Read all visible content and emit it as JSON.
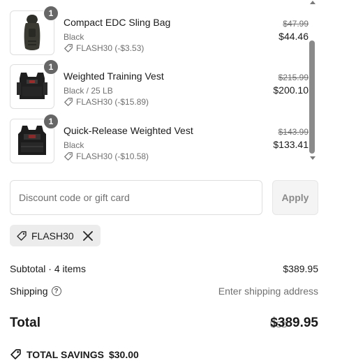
{
  "line_items": [
    {
      "title": "Compact EDC Sling Bag",
      "variant": "Black",
      "discount": "FLASH30 (-$3.53)",
      "original_price": "$47.99",
      "price": "$44.46",
      "quantity": "1",
      "image_icon": "sling-bag-image"
    },
    {
      "title": "Weighted Training Vest",
      "variant": "Black / 25 LB",
      "discount": "FLASH30 (-$15.89)",
      "original_price": "$215.99",
      "price": "$200.10",
      "quantity": "1",
      "image_icon": "weighted-vest-image"
    },
    {
      "title": "Quick-Release Weighted Vest",
      "variant": "Black",
      "discount": "FLASH30 (-$10.58)",
      "original_price": "$143.99",
      "price": "$133.41",
      "quantity": "1",
      "image_icon": "quick-release-vest-image"
    }
  ],
  "discount_form": {
    "placeholder": "Discount code or gift card",
    "value": "",
    "apply_label": "Apply"
  },
  "applied_code": {
    "label": "FLASH30",
    "icon": "tag-icon",
    "remove_icon": "close-icon"
  },
  "summary": {
    "subtotal_label": "Subtotal · 4 items",
    "subtotal_value": "$389.95",
    "shipping_label": "Shipping",
    "shipping_help_glyph": "?",
    "shipping_value": "Enter shipping address",
    "total_label": "Total",
    "total_currency": "USD",
    "total_value": "$389.95",
    "savings_label": "TOTAL SAVINGS",
    "savings_value": "$30.00"
  },
  "colors": {
    "text": "#1a1a1a",
    "muted": "#707070",
    "border": "#dedede",
    "badge": "#666666",
    "chip_bg": "#ececec",
    "button_bg": "#f4f4f4"
  }
}
